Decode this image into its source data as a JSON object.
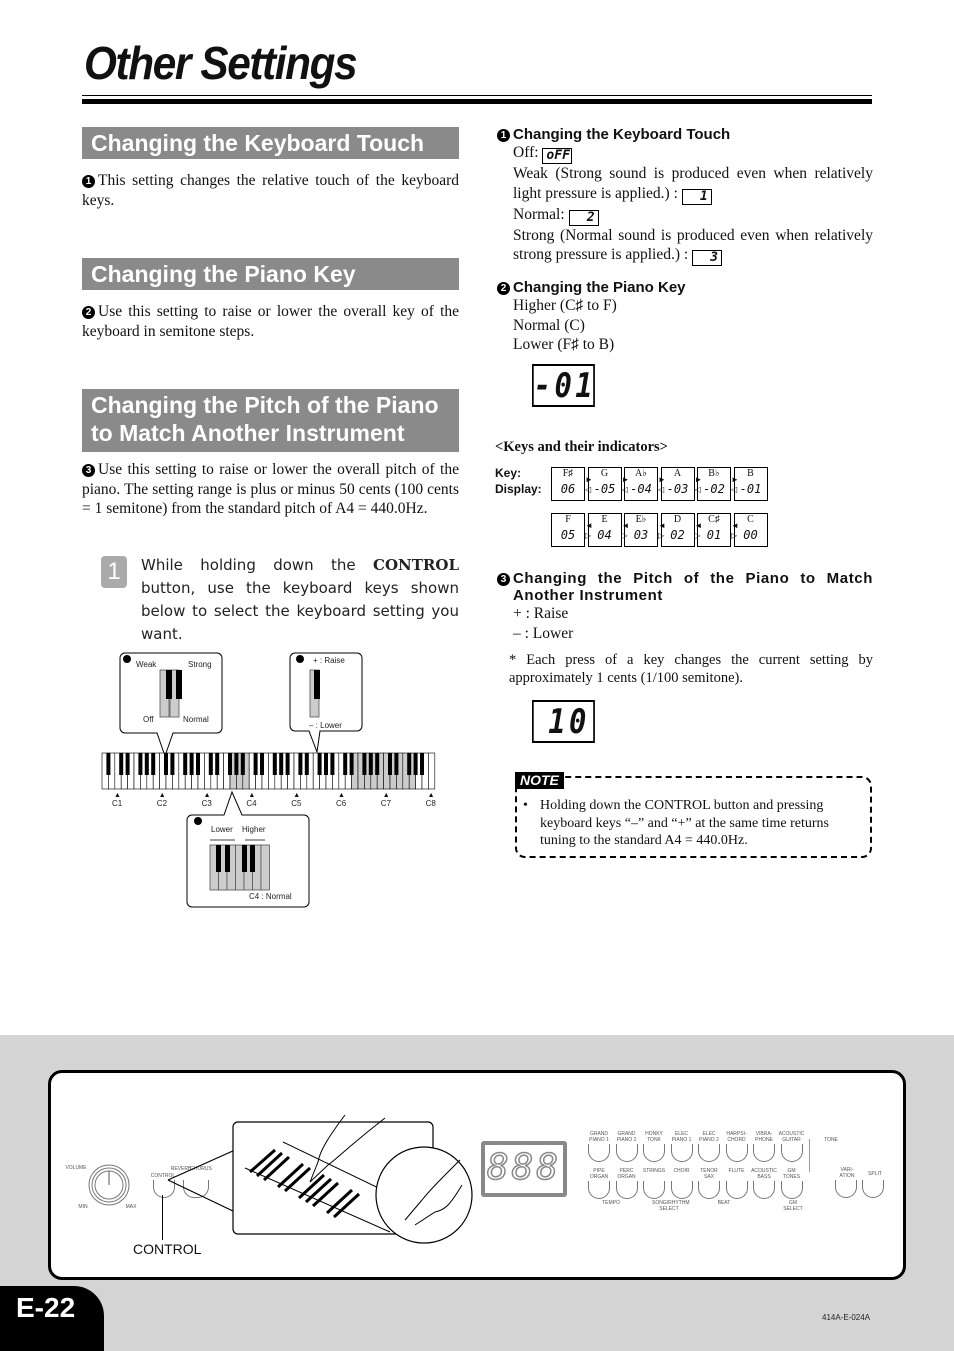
{
  "page": {
    "title": "Other Settings",
    "page_number": "E-22",
    "doc_code": "414A-E-024A"
  },
  "left": {
    "sections": [
      {
        "heading": "Changing the Keyboard Touch",
        "marker": "1",
        "text": "This setting changes the relative touch of the keyboard keys."
      },
      {
        "heading": "Changing the Piano Key",
        "marker": "2",
        "text": "Use this setting to raise or lower the overall key of the keyboard in semitone steps."
      },
      {
        "heading": "Changing the Pitch of the Piano to Match Another Instrument",
        "marker": "3",
        "text": "Use this setting to raise or lower the overall pitch of the piano. The setting range is plus or minus 50 cents (100 cents = 1 semitone) from the standard pitch of A4 = 440.0Hz."
      }
    ],
    "step": {
      "number": "1",
      "text_before": "While holding down the ",
      "text_bold": "CONTROL",
      "text_after": " button, use the keyboard keys shown below to select the keyboard setting you want."
    },
    "diagram": {
      "callout1": {
        "marker": "1",
        "weak": "Weak",
        "strong": "Strong",
        "off": "Off",
        "normal": "Normal"
      },
      "callout3": {
        "marker": "3",
        "raise": "+ : Raise",
        "lower": "– : Lower"
      },
      "callout2": {
        "marker": "2",
        "lower": "Lower",
        "higher": "Higher",
        "normal": "C4 : Normal"
      },
      "octave_labels": [
        "C1",
        "C2",
        "C3",
        "C4",
        "C5",
        "C6",
        "C7",
        "C8"
      ]
    }
  },
  "right": {
    "touch": {
      "marker": "1",
      "heading": "Changing the Keyboard Touch",
      "off_label": "Off:",
      "off_display": "oFF",
      "weak_text": "Weak (Strong sound is produced even when relatively light pressure is applied.) :",
      "weak_display": "1",
      "normal_label": "Normal:",
      "normal_display": "2",
      "strong_text": "Strong (Normal sound is produced even when relatively strong pressure is applied.) :",
      "strong_display": "3"
    },
    "piano_key": {
      "marker": "2",
      "heading": "Changing the Piano Key",
      "lines": [
        "Higher (C♯ to F)",
        "Normal (C)",
        "Lower (F♯ to B)"
      ],
      "display": "-01"
    },
    "indicators": {
      "heading": "<Keys and their indicators>",
      "key_label": "Key:",
      "display_label": "Display:",
      "row1": [
        {
          "key": "F♯",
          "display": "06"
        },
        {
          "key": "G",
          "display": "-05"
        },
        {
          "key": "A♭",
          "display": "-04"
        },
        {
          "key": "A",
          "display": "-03"
        },
        {
          "key": "B♭",
          "display": "-02"
        },
        {
          "key": "B",
          "display": "-01"
        }
      ],
      "row2": [
        {
          "key": "F",
          "display": "05"
        },
        {
          "key": "E",
          "display": "04"
        },
        {
          "key": "E♭",
          "display": "03"
        },
        {
          "key": "D",
          "display": "02"
        },
        {
          "key": "C♯",
          "display": "01"
        },
        {
          "key": "C",
          "display": "00"
        }
      ]
    },
    "pitch": {
      "marker": "3",
      "heading": "Changing the Pitch of the Piano to Match Another Instrument",
      "raise": "+ : Raise",
      "lower": "– : Lower",
      "footnote": "* Each press of a key changes the current setting by approximately 1 cents (1/100 semitone).",
      "display": "10"
    },
    "note": {
      "tag": "NOTE",
      "text": "Holding down the CONTROL button and pressing keyboard keys “–” and “+” at the same time returns tuning to the standard A4 = 440.0Hz."
    }
  },
  "panel": {
    "volume": "VOLUME",
    "min": "MIN",
    "max": "MAX",
    "control_small": "CONTROL",
    "reverb": "REVERB",
    "chorus": "CHORUS",
    "control_callout": "CONTROL",
    "display": "888",
    "tone_row1": [
      "GRAND PIANO 1",
      "GRAND PIANO 2",
      "HONKY TONK",
      "ELEC PIANO 1",
      "ELEC PIANO 2",
      "HARPSI-CHORD",
      "VIBRA-PHONE",
      "ACOUSTIC GUITAR"
    ],
    "tone_row2": [
      "PIPE ORGAN",
      "PERC ORGAN",
      "STRINGS",
      "CHOIR",
      "TENOR SAX",
      "FLUTE",
      "ACOUSTIC BASS",
      "GM TONES"
    ],
    "tone_label": "TONE",
    "variation": "VARI-ATION",
    "split": "SPLIT",
    "tempo": "TEMPO",
    "song_select": "SONG/RHYTHM SELECT",
    "beat": "BEAT",
    "gm_select": "GM SELECT"
  }
}
